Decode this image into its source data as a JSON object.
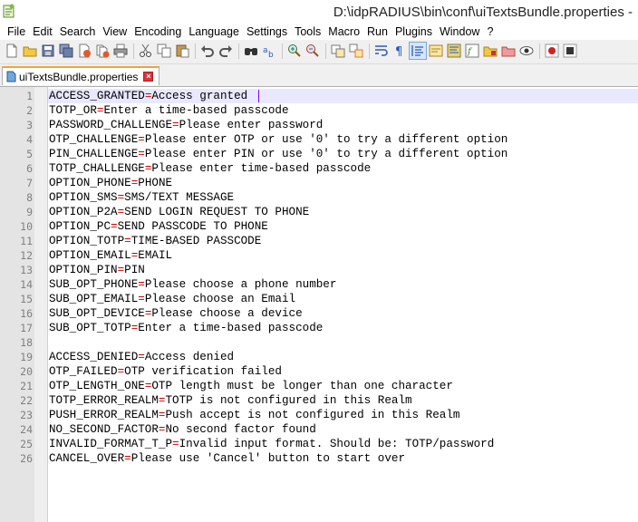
{
  "window": {
    "title": "D:\\idpRADIUS\\bin\\conf\\uiTextsBundle.properties -"
  },
  "menu": [
    {
      "label": "File"
    },
    {
      "label": "Edit"
    },
    {
      "label": "Search"
    },
    {
      "label": "View"
    },
    {
      "label": "Encoding"
    },
    {
      "label": "Language"
    },
    {
      "label": "Settings"
    },
    {
      "label": "Tools"
    },
    {
      "label": "Macro"
    },
    {
      "label": "Run"
    },
    {
      "label": "Plugins"
    },
    {
      "label": "Window"
    },
    {
      "label": "?"
    }
  ],
  "toolbar": {
    "buttons": [
      "new-file-icon",
      "open-file-icon",
      "save-icon",
      "save-all-icon",
      "close-icon",
      "close-all-icon",
      "print-icon",
      "cut-icon",
      "copy-icon",
      "paste-icon",
      "undo-icon",
      "redo-icon",
      "find-icon",
      "replace-icon",
      "zoom-in-icon",
      "zoom-out-icon",
      "sync-vertical-icon",
      "sync-horizontal-icon",
      "word-wrap-icon",
      "all-characters-icon",
      "indent-guide-icon",
      "user-language-icon",
      "document-map-icon",
      "function-list-icon",
      "folder-workspace-icon",
      "monitoring-icon",
      "record-macro-icon",
      "stop-record-icon"
    ]
  },
  "tabs": [
    {
      "label": "uiTextsBundle.properties",
      "active": true
    }
  ],
  "colors": {
    "key": "#000000",
    "operator": "#cc0000",
    "value": "#000000",
    "line_number": "#808080",
    "gutter": "#e4e4e4",
    "current_line": "#e8e8ff",
    "caret": "#8000ff"
  },
  "editor": {
    "lines": [
      {
        "n": "1",
        "key": "ACCESS_GRANTED",
        "eq": "=",
        "value": "Access granted"
      },
      {
        "n": "2",
        "key": "TOTP_OR",
        "eq": "=",
        "value": "Enter a time-based passcode"
      },
      {
        "n": "3",
        "key": "PASSWORD_CHALLENGE",
        "eq": "=",
        "value": "Please enter password"
      },
      {
        "n": "4",
        "key": "OTP_CHALLENGE",
        "eq": "=",
        "value": "Please enter OTP or use '0' to try a different option"
      },
      {
        "n": "5",
        "key": "PIN_CHALLENGE",
        "eq": "=",
        "value": "Please enter PIN or use '0' to try a different option"
      },
      {
        "n": "6",
        "key": "TOTP_CHALLENGE",
        "eq": "=",
        "value": "Please enter time-based passcode"
      },
      {
        "n": "7",
        "key": "OPTION_PHONE",
        "eq": "=",
        "value": "PHONE"
      },
      {
        "n": "8",
        "key": "OPTION_SMS",
        "eq": "=",
        "value": "SMS/TEXT MESSAGE"
      },
      {
        "n": "9",
        "key": "OPTION_P2A",
        "eq": "=",
        "value": "SEND LOGIN REQUEST TO PHONE"
      },
      {
        "n": "10",
        "key": "OPTION_PC",
        "eq": "=",
        "value": "SEND PASSCODE TO PHONE"
      },
      {
        "n": "11",
        "key": "OPTION_TOTP",
        "eq": "=",
        "value": "TIME-BASED PASSCODE"
      },
      {
        "n": "12",
        "key": "OPTION_EMAIL",
        "eq": "=",
        "value": "EMAIL"
      },
      {
        "n": "13",
        "key": "OPTION_PIN",
        "eq": "=",
        "value": "PIN"
      },
      {
        "n": "14",
        "key": "SUB_OPT_PHONE",
        "eq": "=",
        "value": "Please choose a phone number"
      },
      {
        "n": "15",
        "key": "SUB_OPT_EMAIL",
        "eq": "=",
        "value": "Please choose an Email"
      },
      {
        "n": "16",
        "key": "SUB_OPT_DEVICE",
        "eq": "=",
        "value": "Please choose a device"
      },
      {
        "n": "17",
        "key": "SUB_OPT_TOTP",
        "eq": "=",
        "value": "Enter a time-based passcode"
      },
      {
        "n": "18",
        "key": "",
        "eq": "",
        "value": ""
      },
      {
        "n": "19",
        "key": "ACCESS_DENIED",
        "eq": "=",
        "value": "Access denied"
      },
      {
        "n": "20",
        "key": "OTP_FAILED",
        "eq": "=",
        "value": "OTP verification failed"
      },
      {
        "n": "21",
        "key": "OTP_LENGTH_ONE",
        "eq": "=",
        "value": "OTP length must be longer than one character"
      },
      {
        "n": "22",
        "key": "TOTP_ERROR_REALM",
        "eq": "=",
        "value": "TOTP is not configured in this Realm"
      },
      {
        "n": "23",
        "key": "PUSH_ERROR_REALM",
        "eq": "=",
        "value": "Push accept is not configured in this Realm"
      },
      {
        "n": "24",
        "key": "NO_SECOND_FACTOR",
        "eq": "=",
        "value": "No second factor found"
      },
      {
        "n": "25",
        "key": "INVALID_FORMAT_T_P",
        "eq": "=",
        "value": "Invalid input format. Should be: TOTP/password"
      },
      {
        "n": "26",
        "key": "CANCEL_OVER",
        "eq": "=",
        "value": "Please use 'Cancel' button to start over"
      }
    ]
  }
}
